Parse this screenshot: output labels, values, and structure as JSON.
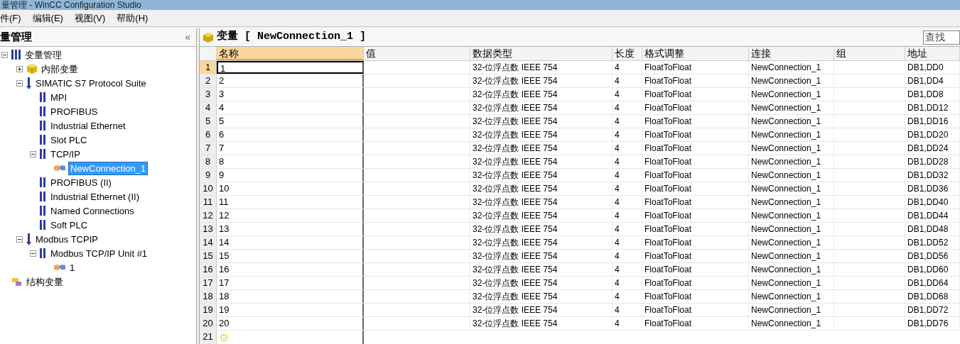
{
  "window": {
    "title": "量管理 - WinCC Configuration Studio"
  },
  "menu": [
    "件(F)",
    "编辑(E)",
    "视图(V)",
    "帮助(H)"
  ],
  "sidebar": {
    "title": "量管理",
    "collapse": "«",
    "tree": [
      {
        "label": "变量管理",
        "kind": "root",
        "expanded": true,
        "selected": false,
        "children": [
          {
            "label": "内部变量",
            "kind": "cube",
            "expanded": false,
            "selected": false
          },
          {
            "label": "SIMATIC S7 Protocol Suite",
            "kind": "protocol",
            "expanded": true,
            "selected": false,
            "children": [
              {
                "label": "MPI",
                "kind": "channel",
                "selected": false
              },
              {
                "label": "PROFIBUS",
                "kind": "channel",
                "selected": false
              },
              {
                "label": "Industrial Ethernet",
                "kind": "channel",
                "selected": false
              },
              {
                "label": "Slot PLC",
                "kind": "channel",
                "selected": false
              },
              {
                "label": "TCP/IP",
                "kind": "channel",
                "expanded": true,
                "selected": false,
                "children": [
                  {
                    "label": "NewConnection_1",
                    "kind": "connection",
                    "selected": true
                  }
                ]
              },
              {
                "label": "PROFIBUS (II)",
                "kind": "channel",
                "selected": false
              },
              {
                "label": "Industrial Ethernet (II)",
                "kind": "channel",
                "selected": false
              },
              {
                "label": "Named Connections",
                "kind": "channel",
                "selected": false
              },
              {
                "label": "Soft PLC",
                "kind": "channel",
                "selected": false
              }
            ]
          },
          {
            "label": "Modbus TCPIP",
            "kind": "protocol",
            "expanded": true,
            "selected": false,
            "children": [
              {
                "label": "Modbus TCP/IP Unit #1",
                "kind": "channel",
                "expanded": true,
                "selected": false,
                "children": [
                  {
                    "label": "1",
                    "kind": "connection",
                    "selected": false
                  }
                ]
              }
            ]
          }
        ]
      },
      {
        "label": "结构变量",
        "kind": "struct",
        "selected": false
      }
    ]
  },
  "content": {
    "title": "变量 [ NewConnection_1 ]",
    "search": {
      "placeholder": "查找"
    }
  },
  "table": {
    "columns": [
      "名称",
      "值",
      "数据类型",
      "长度",
      "格式调整",
      "连接",
      "组",
      "地址"
    ],
    "rows": [
      {
        "no": "1",
        "name": "1",
        "type": "32-位浮点数 IEEE 754",
        "length": "4",
        "format": "FloatToFloat",
        "connection": "NewConnection_1",
        "address": "DB1,DD0",
        "selected": true
      },
      {
        "no": "2",
        "name": "2",
        "type": "32-位浮点数 IEEE 754",
        "length": "4",
        "format": "FloatToFloat",
        "connection": "NewConnection_1",
        "address": "DB1,DD4",
        "selected": false
      },
      {
        "no": "3",
        "name": "3",
        "type": "32-位浮点数 IEEE 754",
        "length": "4",
        "format": "FloatToFloat",
        "connection": "NewConnection_1",
        "address": "DB1,DD8",
        "selected": false
      },
      {
        "no": "4",
        "name": "4",
        "type": "32-位浮点数 IEEE 754",
        "length": "4",
        "format": "FloatToFloat",
        "connection": "NewConnection_1",
        "address": "DB1,DD12",
        "selected": false
      },
      {
        "no": "5",
        "name": "5",
        "type": "32-位浮点数 IEEE 754",
        "length": "4",
        "format": "FloatToFloat",
        "connection": "NewConnection_1",
        "address": "DB1,DD16",
        "selected": false
      },
      {
        "no": "6",
        "name": "6",
        "type": "32-位浮点数 IEEE 754",
        "length": "4",
        "format": "FloatToFloat",
        "connection": "NewConnection_1",
        "address": "DB1,DD20",
        "selected": false
      },
      {
        "no": "7",
        "name": "7",
        "type": "32-位浮点数 IEEE 754",
        "length": "4",
        "format": "FloatToFloat",
        "connection": "NewConnection_1",
        "address": "DB1,DD24",
        "selected": false
      },
      {
        "no": "8",
        "name": "8",
        "type": "32-位浮点数 IEEE 754",
        "length": "4",
        "format": "FloatToFloat",
        "connection": "NewConnection_1",
        "address": "DB1,DD28",
        "selected": false
      },
      {
        "no": "9",
        "name": "9",
        "type": "32-位浮点数 IEEE 754",
        "length": "4",
        "format": "FloatToFloat",
        "connection": "NewConnection_1",
        "address": "DB1,DD32",
        "selected": false
      },
      {
        "no": "10",
        "name": "10",
        "type": "32-位浮点数 IEEE 754",
        "length": "4",
        "format": "FloatToFloat",
        "connection": "NewConnection_1",
        "address": "DB1,DD36",
        "selected": false
      },
      {
        "no": "11",
        "name": "11",
        "type": "32-位浮点数 IEEE 754",
        "length": "4",
        "format": "FloatToFloat",
        "connection": "NewConnection_1",
        "address": "DB1,DD40",
        "selected": false
      },
      {
        "no": "12",
        "name": "12",
        "type": "32-位浮点数 IEEE 754",
        "length": "4",
        "format": "FloatToFloat",
        "connection": "NewConnection_1",
        "address": "DB1,DD44",
        "selected": false
      },
      {
        "no": "13",
        "name": "13",
        "type": "32-位浮点数 IEEE 754",
        "length": "4",
        "format": "FloatToFloat",
        "connection": "NewConnection_1",
        "address": "DB1,DD48",
        "selected": false
      },
      {
        "no": "14",
        "name": "14",
        "type": "32-位浮点数 IEEE 754",
        "length": "4",
        "format": "FloatToFloat",
        "connection": "NewConnection_1",
        "address": "DB1,DD52",
        "selected": false
      },
      {
        "no": "15",
        "name": "15",
        "type": "32-位浮点数 IEEE 754",
        "length": "4",
        "format": "FloatToFloat",
        "connection": "NewConnection_1",
        "address": "DB1,DD56",
        "selected": false
      },
      {
        "no": "16",
        "name": "16",
        "type": "32-位浮点数 IEEE 754",
        "length": "4",
        "format": "FloatToFloat",
        "connection": "NewConnection_1",
        "address": "DB1,DD60",
        "selected": false
      },
      {
        "no": "17",
        "name": "17",
        "type": "32-位浮点数 IEEE 754",
        "length": "4",
        "format": "FloatToFloat",
        "connection": "NewConnection_1",
        "address": "DB1,DD64",
        "selected": false
      },
      {
        "no": "18",
        "name": "18",
        "type": "32-位浮点数 IEEE 754",
        "length": "4",
        "format": "FloatToFloat",
        "connection": "NewConnection_1",
        "address": "DB1,DD68",
        "selected": false
      },
      {
        "no": "19",
        "name": "19",
        "type": "32-位浮点数 IEEE 754",
        "length": "4",
        "format": "FloatToFloat",
        "connection": "NewConnection_1",
        "address": "DB1,DD72",
        "selected": false
      },
      {
        "no": "20",
        "name": "20",
        "type": "32-位浮点数 IEEE 754",
        "length": "4",
        "format": "FloatToFloat",
        "connection": "NewConnection_1",
        "address": "DB1,DD76",
        "selected": false
      }
    ],
    "new_row": {
      "no": "21"
    }
  }
}
